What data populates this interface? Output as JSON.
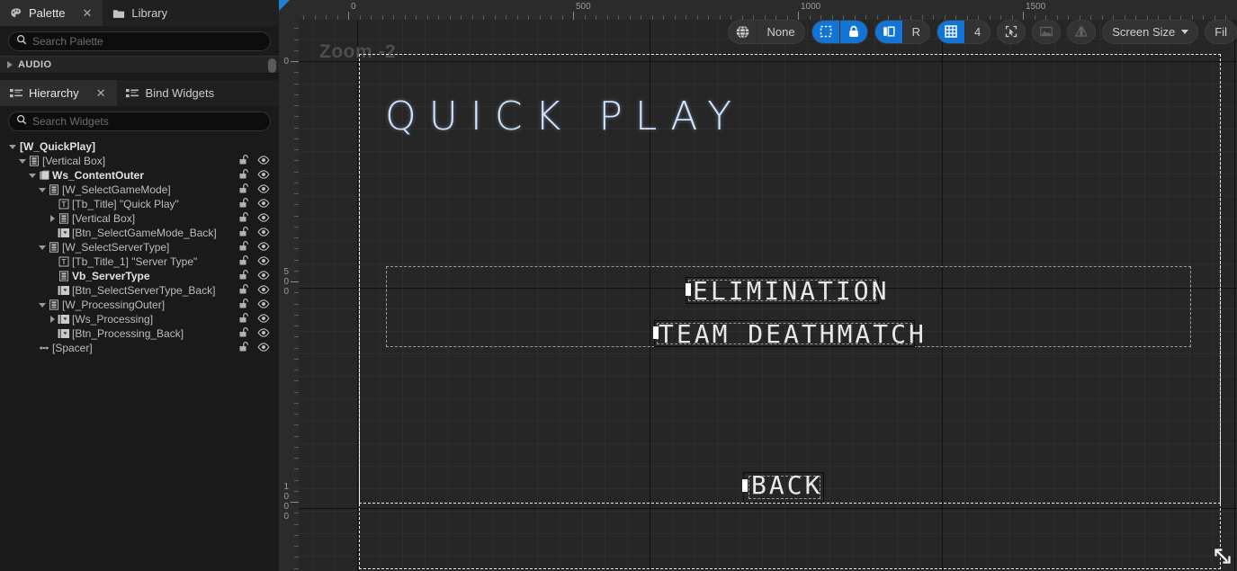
{
  "left_panel": {
    "palette_tabs": [
      {
        "label": "Palette",
        "icon": "palette-icon",
        "active": true,
        "closable": true
      },
      {
        "label": "Library",
        "icon": "folder-icon",
        "active": false,
        "closable": false
      }
    ],
    "palette_search_placeholder": "Search Palette",
    "palette_categories": [
      {
        "label": "AUDIO",
        "expanded": false
      }
    ],
    "hierarchy_tabs": [
      {
        "label": "Hierarchy",
        "icon": "list-icon",
        "active": true,
        "closable": true
      },
      {
        "label": "Bind Widgets",
        "icon": "list-icon",
        "active": false,
        "closable": false
      }
    ],
    "hierarchy_search_placeholder": "Search Widgets"
  },
  "hierarchy": {
    "rows": [
      {
        "label": "[W_QuickPlay]",
        "depth": 0,
        "twist": "down",
        "icon": "none",
        "bold": true,
        "controls": false
      },
      {
        "label": "[Vertical Box]",
        "depth": 1,
        "twist": "down",
        "icon": "vbox",
        "bold": false,
        "controls": true
      },
      {
        "label": "Ws_ContentOuter",
        "depth": 2,
        "twist": "down",
        "icon": "switcher",
        "bold": true,
        "controls": true
      },
      {
        "label": "[W_SelectGameMode]",
        "depth": 3,
        "twist": "down",
        "icon": "vbox",
        "bold": false,
        "controls": true
      },
      {
        "label": "[Tb_Title] \"Quick Play\"",
        "depth": 4,
        "twist": "none",
        "icon": "text",
        "bold": false,
        "controls": true
      },
      {
        "label": "[Vertical Box]",
        "depth": 4,
        "twist": "right",
        "icon": "vbox",
        "bold": false,
        "controls": true
      },
      {
        "label": "[Btn_SelectGameMode_Back]",
        "depth": 4,
        "twist": "none",
        "icon": "button",
        "bold": false,
        "controls": true
      },
      {
        "label": "[W_SelectServerType]",
        "depth": 3,
        "twist": "down",
        "icon": "vbox",
        "bold": false,
        "controls": true
      },
      {
        "label": "[Tb_Title_1] \"Server Type\"",
        "depth": 4,
        "twist": "none",
        "icon": "text",
        "bold": false,
        "controls": true
      },
      {
        "label": "Vb_ServerType",
        "depth": 4,
        "twist": "none",
        "icon": "vbox",
        "bold": true,
        "controls": true
      },
      {
        "label": "[Btn_SelectServerType_Back]",
        "depth": 4,
        "twist": "none",
        "icon": "button",
        "bold": false,
        "controls": true
      },
      {
        "label": "[W_ProcessingOuter]",
        "depth": 3,
        "twist": "down",
        "icon": "vbox",
        "bold": false,
        "controls": true
      },
      {
        "label": "[Ws_Processing]",
        "depth": 4,
        "twist": "right",
        "icon": "button",
        "bold": false,
        "controls": true
      },
      {
        "label": "[Btn_Processing_Back]",
        "depth": 4,
        "twist": "none",
        "icon": "button",
        "bold": false,
        "controls": true
      },
      {
        "label": "[Spacer]",
        "depth": 2,
        "twist": "none",
        "icon": "spacer",
        "bold": false,
        "controls": true
      }
    ],
    "row_icons": {
      "lock": "unlocked-padlock-icon",
      "visibility": "eye-icon"
    }
  },
  "toolbar": {
    "groups": [
      {
        "items": [
          {
            "name": "globe-icon",
            "type": "icon",
            "state": "off"
          },
          {
            "name": "localization-preview-label",
            "type": "text",
            "label": "None"
          }
        ]
      },
      {
        "items": [
          {
            "name": "dashed-outline-icon",
            "type": "icon",
            "state": "on"
          },
          {
            "name": "lock-icon",
            "type": "icon",
            "state": "on"
          }
        ]
      },
      {
        "items": [
          {
            "name": "layout-dpi-icon",
            "type": "icon",
            "state": "on"
          },
          {
            "name": "resolution-r-label",
            "type": "text",
            "label": "R"
          }
        ]
      },
      {
        "items": [
          {
            "name": "grid-snap-icon",
            "type": "icon",
            "state": "on"
          },
          {
            "name": "grid-size-value",
            "type": "text",
            "label": "4"
          }
        ]
      },
      {
        "items": [
          {
            "name": "select-snap-icon",
            "type": "icon",
            "state": "off"
          }
        ]
      },
      {
        "items": [
          {
            "name": "image-preview-icon",
            "type": "icon",
            "state": "disabled"
          }
        ]
      },
      {
        "items": [
          {
            "name": "mirror-icon",
            "type": "icon",
            "state": "disabled"
          }
        ]
      },
      {
        "items": [
          {
            "name": "screen-size-dropdown",
            "type": "dropdown",
            "label": "Screen Size"
          }
        ]
      },
      {
        "items": [
          {
            "name": "fill-dropdown",
            "type": "text",
            "label": "Fil"
          }
        ]
      }
    ]
  },
  "designer": {
    "zoom_label": "Zoom -2",
    "ruler_h": {
      "labels": [
        "0",
        "500",
        "1000",
        "1500"
      ]
    },
    "ruler_v": {
      "labels": [
        "0",
        "500",
        "1000"
      ]
    }
  },
  "preview": {
    "title": "QUICK PLAY",
    "buttons": [
      {
        "label": "ELIMINATION"
      },
      {
        "label": "TEAM DEATHMATCH"
      },
      {
        "label": "BACK"
      }
    ]
  }
}
